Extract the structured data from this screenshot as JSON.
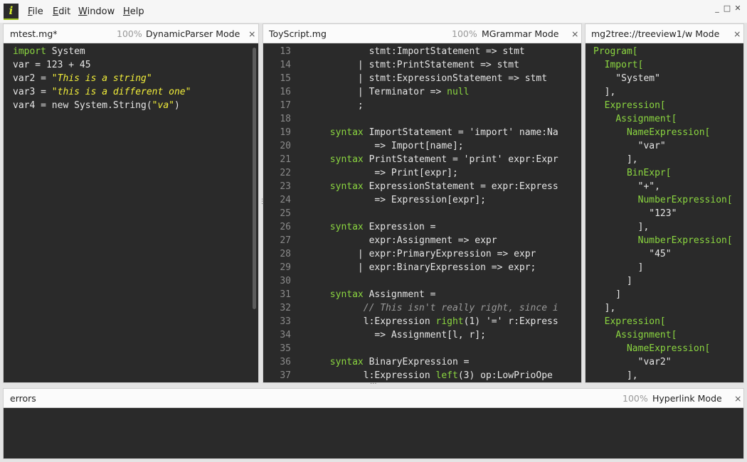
{
  "menu": {
    "file": {
      "key": "F",
      "rest": "ile"
    },
    "edit": {
      "key": "E",
      "rest": "dit"
    },
    "window": {
      "key": "W",
      "rest": "indow"
    },
    "help": {
      "key": "H",
      "rest": "elp"
    }
  },
  "window_controls": {
    "minimize": "_",
    "maximize": "□",
    "close": "✕"
  },
  "panes": {
    "left": {
      "title": "mtest.mg*",
      "zoom": "100%",
      "mode": "DynamicParser Mode",
      "close": "×"
    },
    "middle": {
      "title": "ToyScript.mg",
      "zoom": "100%",
      "mode": "MGrammar Mode",
      "close": "×"
    },
    "right": {
      "title": "mg2tree://treeview1/",
      "mode": "w Mode",
      "close": "×"
    },
    "errors": {
      "title": "errors",
      "zoom": "100%",
      "mode": "Hyperlink Mode",
      "close": "×"
    }
  },
  "left_code": [
    [
      [
        "kw",
        "import"
      ],
      [
        "",
        " System"
      ]
    ],
    [
      [
        "",
        "var = 123 + 45"
      ]
    ],
    [
      [
        "",
        "var2 = "
      ],
      [
        "str",
        "\"This is a string\""
      ]
    ],
    [
      [
        "",
        "var3 = "
      ],
      [
        "str",
        "\"this is a different one\""
      ]
    ],
    [
      [
        "",
        "var4 = new System.String("
      ],
      [
        "str",
        "\"va\""
      ],
      [
        "",
        ")"
      ]
    ]
  ],
  "middle_code": [
    {
      "n": "13",
      "t": [
        [
          "",
          "              stmt:ImportStatement => stmt"
        ]
      ]
    },
    {
      "n": "14",
      "t": [
        [
          "",
          "            | stmt:PrintStatement => stmt"
        ]
      ]
    },
    {
      "n": "15",
      "t": [
        [
          "",
          "            | stmt:ExpressionStatement => stmt"
        ]
      ]
    },
    {
      "n": "16",
      "t": [
        [
          "",
          "            | Terminator => "
        ],
        [
          "kw",
          "null"
        ]
      ]
    },
    {
      "n": "17",
      "t": [
        [
          "",
          "            ;"
        ]
      ]
    },
    {
      "n": "18",
      "t": []
    },
    {
      "n": "19",
      "t": [
        [
          "",
          "       "
        ],
        [
          "kw",
          "syntax"
        ],
        [
          "",
          " ImportStatement = 'import' name:Na"
        ]
      ]
    },
    {
      "n": "20",
      "t": [
        [
          "",
          "               => Import[name];"
        ]
      ]
    },
    {
      "n": "21",
      "t": [
        [
          "",
          "       "
        ],
        [
          "kw",
          "syntax"
        ],
        [
          "",
          " PrintStatement = 'print' expr:Expr"
        ]
      ]
    },
    {
      "n": "22",
      "t": [
        [
          "",
          "               => Print[expr];"
        ]
      ]
    },
    {
      "n": "23",
      "t": [
        [
          "",
          "       "
        ],
        [
          "kw",
          "syntax"
        ],
        [
          "",
          " ExpressionStatement = expr:Express"
        ]
      ]
    },
    {
      "n": "24",
      "t": [
        [
          "",
          "               => Expression[expr];"
        ]
      ]
    },
    {
      "n": "25",
      "t": []
    },
    {
      "n": "26",
      "t": [
        [
          "",
          "       "
        ],
        [
          "kw",
          "syntax"
        ],
        [
          "",
          " Expression ="
        ]
      ]
    },
    {
      "n": "27",
      "t": [
        [
          "",
          "              expr:Assignment => expr"
        ]
      ]
    },
    {
      "n": "28",
      "t": [
        [
          "",
          "            | expr:PrimaryExpression => expr"
        ]
      ]
    },
    {
      "n": "29",
      "t": [
        [
          "",
          "            | expr:BinaryExpression => expr;"
        ]
      ]
    },
    {
      "n": "30",
      "t": []
    },
    {
      "n": "31",
      "t": [
        [
          "",
          "       "
        ],
        [
          "kw",
          "syntax"
        ],
        [
          "",
          " Assignment ="
        ]
      ]
    },
    {
      "n": "32",
      "t": [
        [
          "",
          "             "
        ],
        [
          "cm",
          "// This isn't really right, since i"
        ]
      ]
    },
    {
      "n": "33",
      "t": [
        [
          "",
          "             l:Expression "
        ],
        [
          "kw",
          "right"
        ],
        [
          "",
          "(1) '=' r:Express"
        ]
      ]
    },
    {
      "n": "34",
      "t": [
        [
          "",
          "               => Assignment[l, r];"
        ]
      ]
    },
    {
      "n": "35",
      "t": []
    },
    {
      "n": "36",
      "t": [
        [
          "",
          "       "
        ],
        [
          "kw",
          "syntax"
        ],
        [
          "",
          " BinaryExpression ="
        ]
      ]
    },
    {
      "n": "37",
      "t": [
        [
          "",
          "             l:Expression "
        ],
        [
          "kw",
          "left"
        ],
        [
          "",
          "(3) op:LowPrioOpe"
        ]
      ]
    }
  ],
  "right_code": [
    [
      [
        "kw",
        "Program["
      ]
    ],
    [
      [
        "",
        "  "
      ],
      [
        "kw",
        "Import["
      ]
    ],
    [
      [
        "",
        "    \"System\""
      ]
    ],
    [
      [
        "",
        "  ],"
      ]
    ],
    [
      [
        "",
        "  "
      ],
      [
        "kw",
        "Expression["
      ]
    ],
    [
      [
        "",
        "    "
      ],
      [
        "kw",
        "Assignment["
      ]
    ],
    [
      [
        "",
        "      "
      ],
      [
        "kw",
        "NameExpression["
      ]
    ],
    [
      [
        "",
        "        \"var\""
      ]
    ],
    [
      [
        "",
        "      ],"
      ]
    ],
    [
      [
        "",
        "      "
      ],
      [
        "kw",
        "BinExpr["
      ]
    ],
    [
      [
        "",
        "        \"+\","
      ]
    ],
    [
      [
        "",
        "        "
      ],
      [
        "kw",
        "NumberExpression["
      ]
    ],
    [
      [
        "",
        "          \"123\""
      ]
    ],
    [
      [
        "",
        "        ],"
      ]
    ],
    [
      [
        "",
        "        "
      ],
      [
        "kw",
        "NumberExpression["
      ]
    ],
    [
      [
        "",
        "          \"45\""
      ]
    ],
    [
      [
        "",
        "        ]"
      ]
    ],
    [
      [
        "",
        "      ]"
      ]
    ],
    [
      [
        "",
        "    ]"
      ]
    ],
    [
      [
        "",
        "  ],"
      ]
    ],
    [
      [
        "",
        "  "
      ],
      [
        "kw",
        "Expression["
      ]
    ],
    [
      [
        "",
        "    "
      ],
      [
        "kw",
        "Assignment["
      ]
    ],
    [
      [
        "",
        "      "
      ],
      [
        "kw",
        "NameExpression["
      ]
    ],
    [
      [
        "",
        "        \"var2\""
      ]
    ],
    [
      [
        "",
        "      ],"
      ]
    ]
  ],
  "colors": {
    "keyword": "#8bd640",
    "string": "#f2ee3a",
    "comment": "#9a9a9a",
    "editor_bg": "#2a2a2a"
  }
}
